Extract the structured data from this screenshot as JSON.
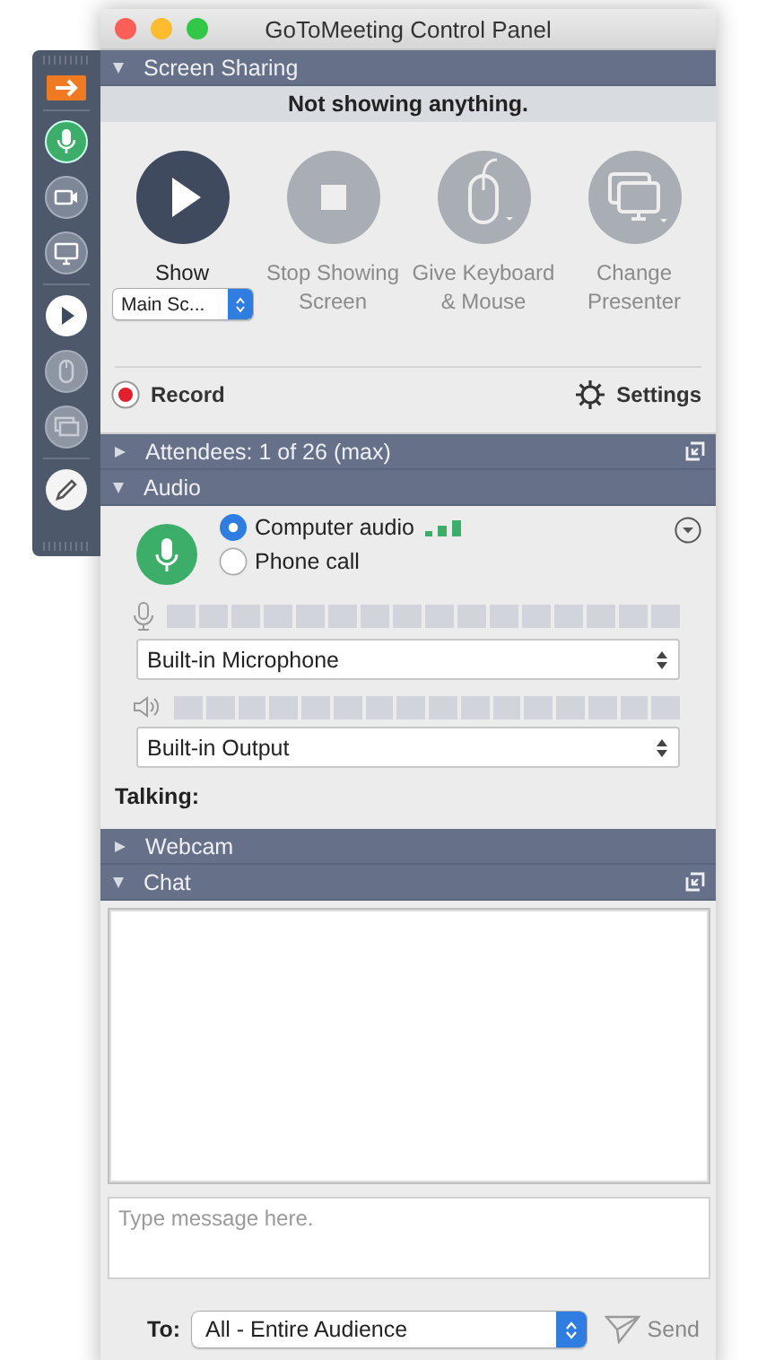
{
  "window": {
    "title": "GoToMeeting Control Panel"
  },
  "dock": [
    {
      "kind": "arrow"
    },
    {
      "kind": "mic"
    },
    {
      "kind": "camera"
    },
    {
      "kind": "monitor"
    },
    {
      "kind": "play"
    },
    {
      "kind": "mouse"
    },
    {
      "kind": "screens"
    },
    {
      "kind": "pencil"
    }
  ],
  "screen_sharing": {
    "header": {
      "label": "Screen Sharing",
      "expanded": true,
      "popout": false
    },
    "status": "Not showing anything.",
    "actions": [
      {
        "kind": "play",
        "label": "Show",
        "enabled": true
      },
      {
        "kind": "stop",
        "label": "Stop Showing Screen",
        "enabled": false
      },
      {
        "kind": "mouse",
        "label": "Give Keyboard & Mouse",
        "enabled": false
      },
      {
        "kind": "screens",
        "label": "Change Presenter",
        "enabled": false
      }
    ],
    "screen_select": "Main Sc...",
    "record": "Record",
    "settings": "Settings"
  },
  "attendees": {
    "header": {
      "label": "Attendees: 1 of 26 (max)",
      "expanded": false,
      "popout": true
    }
  },
  "audio": {
    "header": {
      "label": "Audio",
      "expanded": true,
      "popout": false
    },
    "options": [
      {
        "label": "Computer audio",
        "selected": true
      },
      {
        "label": "Phone call",
        "selected": false
      }
    ],
    "mic_device": "Built-in Microphone",
    "speaker_device": "Built-in Output",
    "talking": "Talking:"
  },
  "webcam": {
    "header": {
      "label": "Webcam",
      "expanded": false,
      "popout": false
    }
  },
  "chat": {
    "header": {
      "label": "Chat",
      "expanded": true,
      "popout": true
    },
    "placeholder": "Type message here.",
    "to_label": "To:",
    "recipient": "All - Entire Audience",
    "send": "Send"
  }
}
